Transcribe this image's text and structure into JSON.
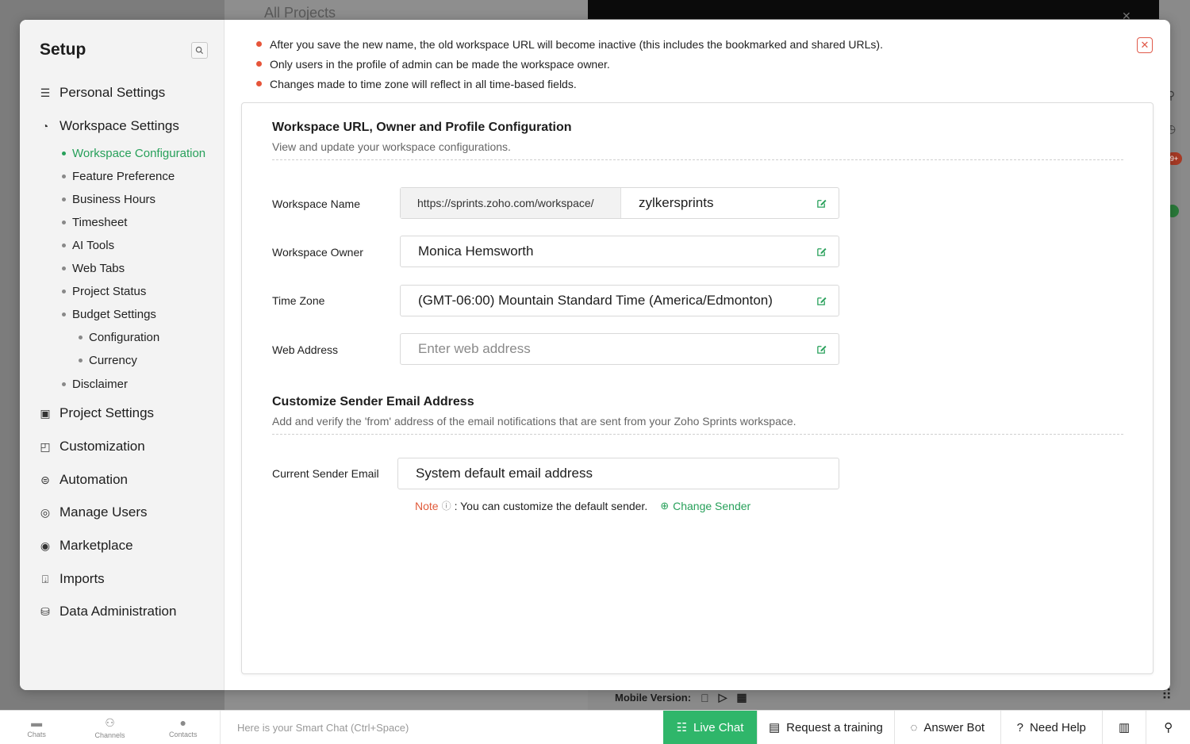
{
  "background": {
    "title": "All Projects",
    "mobile_version_label": "Mobile Version:",
    "rail_badge": "9+"
  },
  "sidebar": {
    "title": "Setup",
    "sections": {
      "personal": "Personal Settings",
      "workspace": "Workspace Settings",
      "project": "Project Settings",
      "customization": "Customization",
      "automation": "Automation",
      "manage_users": "Manage Users",
      "marketplace": "Marketplace",
      "imports": "Imports",
      "data_admin": "Data Administration"
    },
    "workspace_items": {
      "workspace_configuration": "Workspace Configuration",
      "feature_preference": "Feature Preference",
      "business_hours": "Business Hours",
      "timesheet": "Timesheet",
      "ai_tools": "AI Tools",
      "web_tabs": "Web Tabs",
      "project_status": "Project Status",
      "budget_settings": "Budget Settings",
      "configuration": "Configuration",
      "currency": "Currency",
      "disclaimer": "Disclaimer"
    }
  },
  "notes": [
    "After you save the new name, the old workspace URL will become inactive (this includes the bookmarked and shared URLs).",
    "Only users in the profile of admin can be made the workspace owner.",
    "Changes made to time zone will reflect in all time-based fields."
  ],
  "workspace_section": {
    "title": "Workspace URL, Owner and Profile Configuration",
    "description": "View and update your workspace configurations.",
    "fields": {
      "name_label": "Workspace Name",
      "name_prefix": "https://sprints.zoho.com/workspace/",
      "name_value": "zylkersprints",
      "owner_label": "Workspace Owner",
      "owner_value": "Monica Hemsworth",
      "timezone_label": "Time Zone",
      "timezone_value": "(GMT-06:00) Mountain Standard Time (America/Edmonton)",
      "web_label": "Web Address",
      "web_placeholder": "Enter web address"
    }
  },
  "sender_section": {
    "title": "Customize Sender Email Address",
    "description": "Add and verify the 'from' address of the email notifications that are sent from your Zoho Sprints workspace.",
    "current_label": "Current Sender Email",
    "current_value": "System default email address",
    "note_label": "Note",
    "note_text": ": You can customize the default sender.",
    "change_sender": "Change Sender"
  },
  "bottombar": {
    "chats": "Chats",
    "channels": "Channels",
    "contacts": "Contacts",
    "smart_chat_placeholder": "Here is your Smart Chat (Ctrl+Space)",
    "live_chat": "Live Chat",
    "request_training": "Request a training",
    "answer_bot": "Answer Bot",
    "need_help": "Need Help"
  },
  "colors": {
    "accent_green": "#27a05a",
    "live_chat_bg": "#2fb66a",
    "note_red": "#e05a3a",
    "bullet_red": "#e6553a"
  }
}
